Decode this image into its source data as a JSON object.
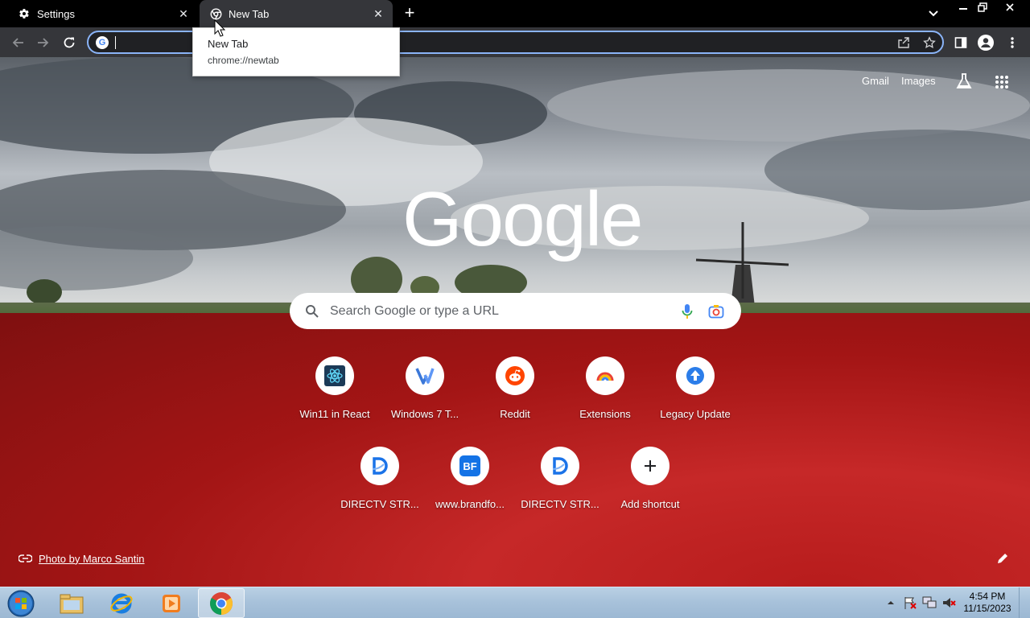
{
  "tabs": [
    {
      "title": "Settings",
      "icon": "gear-icon"
    },
    {
      "title": "New Tab",
      "icon": "chrome-icon"
    }
  ],
  "omnibox": {
    "value": ""
  },
  "tooltip": {
    "title": "New Tab",
    "url": "chrome://newtab"
  },
  "ntp": {
    "gmail_label": "Gmail",
    "images_label": "Images",
    "logo_text": "Google",
    "search_placeholder": "Search Google or type a URL",
    "photo_credit": "Photo by Marco Santin",
    "shortcuts": [
      {
        "label": "Win11 in React",
        "icon": "win11-react-icon"
      },
      {
        "label": "Windows 7 T...",
        "icon": "windows7-icon"
      },
      {
        "label": "Reddit",
        "icon": "reddit-icon"
      },
      {
        "label": "Extensions",
        "icon": "extensions-icon"
      },
      {
        "label": "Legacy Update",
        "icon": "legacy-update-icon"
      },
      {
        "label": "DIRECTV STR...",
        "icon": "directv-icon"
      },
      {
        "label": "www.brandfo...",
        "icon": "brandfolder-icon"
      },
      {
        "label": "DIRECTV STR...",
        "icon": "directv-icon"
      },
      {
        "label": "Add shortcut",
        "icon": "plus-icon"
      }
    ]
  },
  "taskbar": {
    "apps": [
      "explorer-icon",
      "internet-explorer-icon",
      "media-player-icon",
      "chrome-icon"
    ],
    "time": "4:54 PM",
    "date": "11/15/2023"
  },
  "colors": {
    "accent": "#8ab4f8",
    "toolbar": "#35363a",
    "tabstrip": "#000000"
  }
}
